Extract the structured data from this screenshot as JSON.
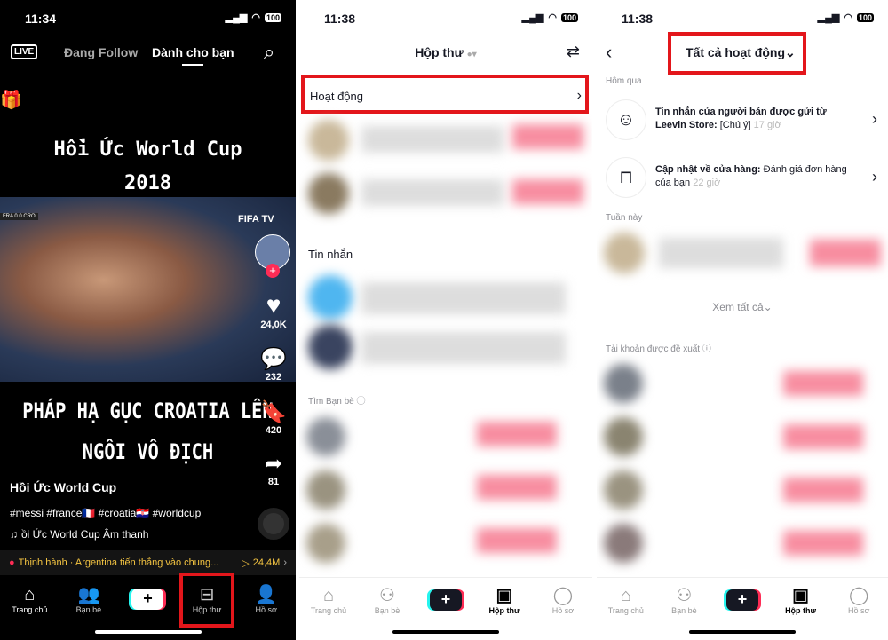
{
  "panel1": {
    "status": {
      "time": "11:34",
      "battery": "100"
    },
    "tabs": {
      "following": "Đang Follow",
      "for_you": "Dành cho bạn"
    },
    "live_label": "LIVE",
    "video_title": "Hồi Ức World Cup 2018",
    "scoreboard": "FRA 0 0 CRO",
    "watermark": "FIFA TV",
    "caption": "PHÁP HẠ GỤC CROATIA LÊN NGÔI VÔ ĐỊCH",
    "likes": "24,0K",
    "comments": "232",
    "saves": "420",
    "shares": "81",
    "author": "Hồi Ức World Cup",
    "hashtags": "#messi #france🇫🇷 #croatia🇭🇷 #worldcup",
    "sound": "ồi Ức World Cup Âm thanh",
    "trending": {
      "label": "Thịnh hành · Argentina tiến thẳng vào chung...",
      "views": "24,4M"
    }
  },
  "panel2": {
    "status": {
      "time": "11:38",
      "battery": "100"
    },
    "title": "Hộp thư",
    "activity_label": "Hoạt động",
    "messages_label": "Tin nhắn",
    "find_friends_label": "Tìm Bạn bè"
  },
  "panel3": {
    "status": {
      "time": "11:38",
      "battery": "100"
    },
    "title": "Tất cả hoạt động",
    "yesterday": "Hôm qua",
    "items": [
      {
        "bold": "Tin nhắn của người bán được gửi từ Leevin Store:",
        "text": " [Chú ý]",
        "time": " 17 giờ"
      },
      {
        "bold": "Cập nhật về cửa hàng:",
        "text": " Đánh giá đơn hàng của bạn",
        "time": " 22 giờ"
      }
    ],
    "this_week": "Tuần này",
    "see_all": "Xem tất cả",
    "suggested": "Tài khoản được đề xuất"
  },
  "nav": {
    "home": "Trang chủ",
    "friends": "Bạn bè",
    "create": "+",
    "inbox": "Hộp thư",
    "profile": "Hồ sơ"
  },
  "colors": {
    "highlight": "#e3161b",
    "accent": "#fe2c55",
    "trending": "#f5c542"
  }
}
